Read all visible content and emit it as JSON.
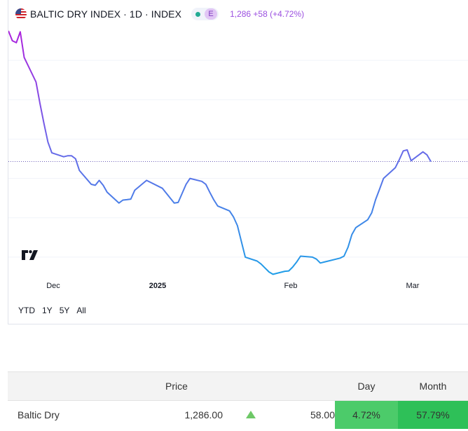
{
  "header": {
    "symbol_title": "BALTIC DRY INDEX · 1D · INDEX",
    "badge_letter": "E",
    "quote": "1,286 +58 (+4.72%)"
  },
  "colors": {
    "line_start": "#b21bdc",
    "line_mid": "#7063e8",
    "line_end": "#1e9fe8",
    "market_open": "#22ab94",
    "positive_cell": "#4ccb6a"
  },
  "chart_data": {
    "type": "line",
    "x_ticks": [
      "Dec",
      "2025",
      "Feb",
      "Mar"
    ],
    "ylim": [
      700,
      2000
    ],
    "last_value": 1286,
    "grid": true,
    "series": [
      {
        "x": [
          "2024-11-18",
          "2024-11-19",
          "2024-11-20",
          "2024-11-21",
          "2024-11-22",
          "2024-11-25",
          "2024-11-26",
          "2024-11-27",
          "2024-11-28",
          "2024-11-29",
          "2024-12-02",
          "2024-12-03",
          "2024-12-04",
          "2024-12-05",
          "2024-12-06",
          "2024-12-09",
          "2024-12-10",
          "2024-12-11",
          "2024-12-12",
          "2024-12-13",
          "2024-12-16",
          "2024-12-17",
          "2024-12-18",
          "2024-12-19",
          "2024-12-20",
          "2024-12-23",
          "2024-12-27",
          "2024-12-30",
          "2024-12-31",
          "2025-01-02",
          "2025-01-03",
          "2025-01-06",
          "2025-01-07",
          "2025-01-08",
          "2025-01-09",
          "2025-01-10",
          "2025-01-13",
          "2025-01-14",
          "2025-01-15",
          "2025-01-16",
          "2025-01-17",
          "2025-01-20",
          "2025-01-21",
          "2025-01-22",
          "2025-01-23",
          "2025-01-24",
          "2025-01-27",
          "2025-01-28",
          "2025-01-29",
          "2025-01-30",
          "2025-01-31",
          "2025-02-03",
          "2025-02-04",
          "2025-02-05",
          "2025-02-06",
          "2025-02-07",
          "2025-02-10",
          "2025-02-11",
          "2025-02-12",
          "2025-02-13",
          "2025-02-14",
          "2025-02-17",
          "2025-02-18",
          "2025-02-19",
          "2025-02-20",
          "2025-02-21",
          "2025-02-24",
          "2025-02-25",
          "2025-02-26",
          "2025-02-27",
          "2025-02-28",
          "2025-03-03",
          "2025-03-04",
          "2025-03-05"
        ],
        "values": [
          1950,
          1900,
          1890,
          1945,
          1815,
          1690,
          1580,
          1480,
          1385,
          1330,
          1310,
          1315,
          1315,
          1300,
          1240,
          1170,
          1165,
          1190,
          1165,
          1130,
          1075,
          1090,
          1092,
          1095,
          1140,
          1190,
          1150,
          1075,
          1078,
          1170,
          1200,
          1185,
          1170,
          1130,
          1092,
          1060,
          1035,
          1005,
          960,
          880,
          800,
          780,
          765,
          745,
          725,
          713,
          728,
          730,
          750,
          775,
          805,
          800,
          790,
          770,
          775,
          780,
          795,
          805,
          850,
          915,
          950,
          990,
          1025,
          1092,
          1145,
          1200,
          1255,
          1295,
          1340,
          1345,
          1290,
          1335,
          1320,
          1286
        ]
      }
    ]
  },
  "range_buttons": [
    "YTD",
    "1Y",
    "5Y",
    "All"
  ],
  "table": {
    "headers": {
      "name": "",
      "price": "Price",
      "arrow": "",
      "change": "",
      "day": "Day",
      "month": "Month"
    },
    "rows": [
      {
        "name": "Baltic Dry",
        "price": "1,286.00",
        "direction": "up",
        "change": "58.00",
        "day": "4.72%",
        "month": "57.79%"
      }
    ]
  }
}
